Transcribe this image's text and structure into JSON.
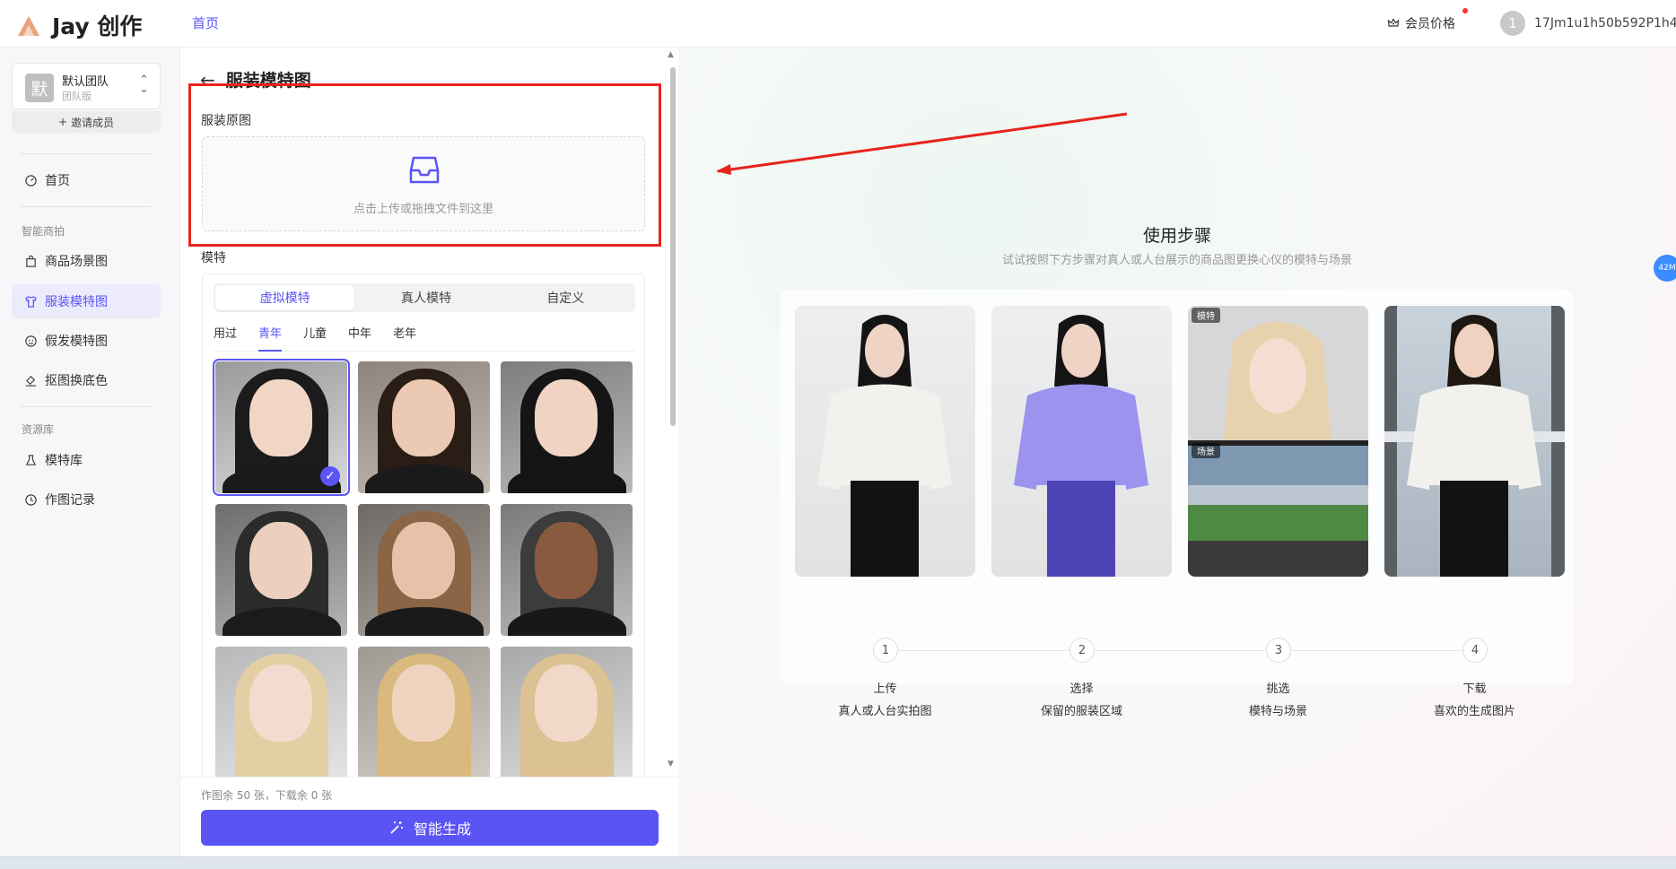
{
  "header": {
    "logo_text": "Jay 创作",
    "nav_home": "首页",
    "member_price": "会员价格",
    "user_avatar_text": "1",
    "user_name": "17Jm1u1h50b592P1h4"
  },
  "sidebar": {
    "team_avatar": "默",
    "team_name": "默认团队",
    "team_plan": "团队版",
    "invite": "邀请成员",
    "home": "首页",
    "section_smart": "智能商拍",
    "items_smart": [
      "商品场景图",
      "服装模特图",
      "假发模特图",
      "抠图换底色"
    ],
    "section_resources": "资源库",
    "items_resources": [
      "模特库",
      "作图记录"
    ]
  },
  "panel": {
    "title": "服装模特图",
    "upload_label": "服装原图",
    "upload_hint": "点击上传或拖拽文件到这里",
    "model_label": "模特",
    "tabs": [
      "虚拟模特",
      "真人模特",
      "自定义"
    ],
    "ages": [
      "用过",
      "青年",
      "儿童",
      "中年",
      "老年"
    ],
    "quota": "作图余 50 张，下载余 0 张",
    "generate": "智能生成"
  },
  "main": {
    "usage_title": "使用步骤",
    "usage_sub": "试试按照下方步骤对真人或人台展示的商品图更换心仪的模特与场景",
    "badge_model": "模特",
    "badge_scene": "场景",
    "steps": [
      {
        "num": "1",
        "title": "上传",
        "desc": "真人或人台实拍图"
      },
      {
        "num": "2",
        "title": "选择",
        "desc": "保留的服装区域"
      },
      {
        "num": "3",
        "title": "挑选",
        "desc": "模特与场景"
      },
      {
        "num": "4",
        "title": "下载",
        "desc": "喜欢的生成图片"
      }
    ],
    "mem_bubble": "42M"
  },
  "colors": {
    "accent": "#5b54f5",
    "annotation_red": "#e8231c"
  }
}
